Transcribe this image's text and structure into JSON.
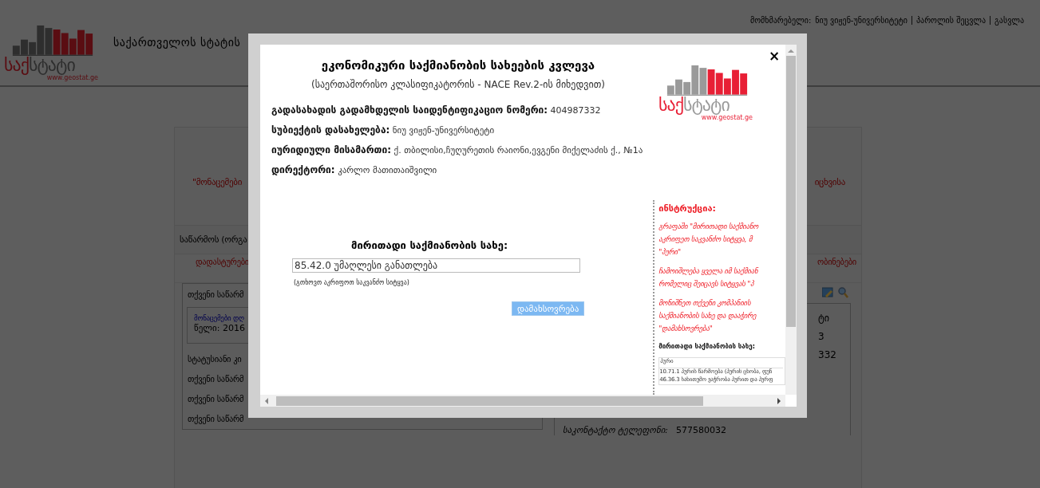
{
  "header": {
    "logo": {
      "red": "საქ",
      "gray": "სტატი",
      "url": "www.geostat.ge"
    },
    "site_title": "საქართველოს სტატის",
    "user_label": "მომხმარებელი:",
    "user_name": "ნიუ ვიჟენ-უნივერსიტეტი",
    "links": [
      "პაროლის შეცვლა",
      "გასვლა"
    ]
  },
  "background_panel": {
    "notice_left": "\"მონაცემები",
    "notice_right": "იცხვისა",
    "section_title": "საწარმოს (ორგა",
    "confirm_link": "დადასტურები",
    "notices_link": "ობინებები",
    "box_title": "თქვენი საწარმ",
    "data_link": "მონაცემები დღ",
    "year": "წელი: 2016",
    "rows": [
      "სტატუსიანი კი",
      "თქვენი საწარმ",
      "თქვენი საწარმ",
      "თქვენი საწარმ"
    ],
    "right_values": [
      "ტი",
      "3",
      "332"
    ],
    "phone_label": "საკონტაქტო ტელეფონი:",
    "phone": "577580032"
  },
  "modal": {
    "logo": {
      "red": "საქ",
      "gray": "სტატი",
      "url": "www.geostat.ge"
    },
    "title": "ეკონომიკური საქმიანობის სახეების კვლევა",
    "subtitle": "(საერთაშორისო კლასიფიკატორის - NACE Rev.2-ის მიხედვით)",
    "close": "×",
    "fields": [
      {
        "label": "გადასახადის გადამხდელის საიდენტიფიკაციო ნომერი:",
        "value": "404987332"
      },
      {
        "label": "სუბიექტის დასახელება:",
        "value": "ნიუ ვიჟენ-უნივერსიტეტი"
      },
      {
        "label": "იურიდიული მისამართი:",
        "value": "ქ. თბილისი,ჩუღურეთის რაიონი,ევგენი მიქელაძის ქ., №1ა"
      },
      {
        "label": "დირექტორი:",
        "value": "კარლო მათითაიშვილი"
      }
    ],
    "activity_label": "მირითადი საქმიანობის სახე:",
    "activity_value": "85.42.0 უმაღლესი განათლება",
    "hint": "(გთხოვთ აკრიფოთ საკვანძო სიტყვა)",
    "save_button": "დამახსოვრება",
    "instructions": {
      "title": "ინსტრუქცია:",
      "paragraphs": [
        [
          "გრაფაში \"მირითადი საქმიანო",
          "აკრიფეთ საკვანძო სიტყვა, მ",
          "\"პური\""
        ],
        [
          "ჩამოიშლება ყველა იმ საქმიან",
          "რომელიც შეიცავს სიტყვას \"პ"
        ],
        [
          "მონიშნეთ თქვენი კომპანიის",
          "საქმიანობის სახე და დააჭირე",
          "\"დამახსოვრება\""
        ]
      ],
      "list_label": "მირითადი საქმიანობის სახე:",
      "search_value": "პური",
      "options": [
        "10.71.1 პურის წარმოება (პურის ცხობა, ფუნ",
        "46.36.3 სახითუმო ვაჭრობა პურით და პურფ"
      ]
    }
  }
}
